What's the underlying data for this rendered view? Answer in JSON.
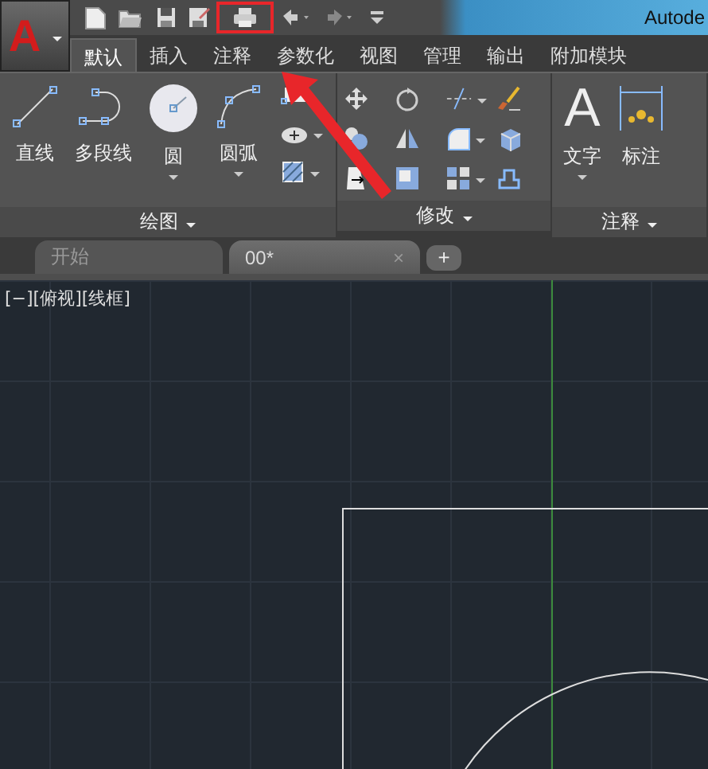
{
  "app_button": {
    "logo": "A"
  },
  "quick_access": {
    "tools": [
      {
        "kind": "new",
        "highlighted": false
      },
      {
        "kind": "open",
        "highlighted": false
      },
      {
        "kind": "save",
        "highlighted": false
      },
      {
        "kind": "saveas",
        "highlighted": false
      },
      {
        "kind": "print",
        "highlighted": true
      },
      {
        "kind": "undo",
        "highlighted": false
      },
      {
        "kind": "redo",
        "highlighted": false
      },
      {
        "kind": "more",
        "highlighted": false
      }
    ]
  },
  "window": {
    "title": "Autode"
  },
  "ribbon_tabs": [
    {
      "label": "默认",
      "selected": true
    },
    {
      "label": "插入",
      "selected": false
    },
    {
      "label": "注释",
      "selected": false
    },
    {
      "label": "参数化",
      "selected": false
    },
    {
      "label": "视图",
      "selected": false
    },
    {
      "label": "管理",
      "selected": false
    },
    {
      "label": "输出",
      "selected": false
    },
    {
      "label": "附加模块",
      "selected": false
    }
  ],
  "panels": [
    {
      "title": "绘图",
      "big_tools": [
        {
          "kind": "line",
          "label": "直线",
          "dropdown": false
        },
        {
          "kind": "polyline",
          "label": "多段线",
          "dropdown": false
        },
        {
          "kind": "circle",
          "label": "圆",
          "dropdown": true
        },
        {
          "kind": "arc",
          "label": "圆弧",
          "dropdown": true
        }
      ],
      "small_tools": [
        {
          "kind": "rect",
          "dropdown": false
        },
        {
          "kind": "ellipse",
          "dropdown": true
        },
        {
          "kind": "hatch",
          "dropdown": true
        }
      ]
    },
    {
      "title": "修改",
      "grid": [
        {
          "kind": "move",
          "dropdown": false
        },
        {
          "kind": "rotate",
          "dropdown": false
        },
        {
          "kind": "trim",
          "dropdown": true
        },
        {
          "kind": "erase",
          "dropdown": false
        },
        {
          "kind": "copy",
          "dropdown": false
        },
        {
          "kind": "mirror",
          "dropdown": false
        },
        {
          "kind": "fillet",
          "dropdown": true
        },
        {
          "kind": "explode",
          "dropdown": false
        },
        {
          "kind": "stretch",
          "dropdown": false
        },
        {
          "kind": "scale",
          "dropdown": false
        },
        {
          "kind": "array",
          "dropdown": true
        },
        {
          "kind": "offset",
          "dropdown": false
        }
      ]
    },
    {
      "title": "注释",
      "big_tools": [
        {
          "kind": "text",
          "glyph": "A",
          "label": "文字",
          "dropdown": true
        },
        {
          "kind": "dimension",
          "label": "标注",
          "dropdown": false
        }
      ]
    }
  ],
  "doc_tabs": [
    {
      "label": "开始",
      "selected": false
    },
    {
      "label": "00*",
      "selected": true,
      "close": "×"
    }
  ],
  "new_tab": "+",
  "viewport_label": "[−][俯视][线框]"
}
